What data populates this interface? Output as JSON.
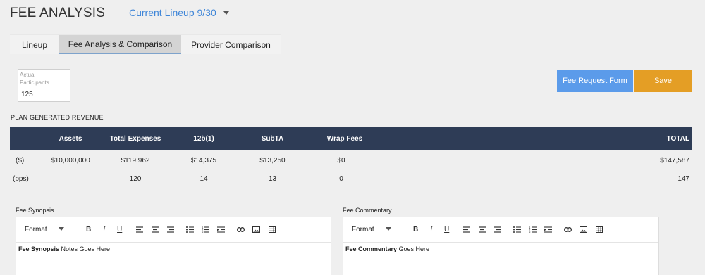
{
  "header": {
    "title": "FEE ANALYSIS",
    "lineup_selected": "Current Lineup 9/30"
  },
  "tabs": [
    {
      "label": "Lineup",
      "active": false
    },
    {
      "label": "Fee Analysis & Comparison",
      "active": true
    },
    {
      "label": "Provider Comparison",
      "active": false
    }
  ],
  "participants": {
    "label": "Actual Participants",
    "value": "125"
  },
  "buttons": {
    "fee_request": "Fee Request Form",
    "save": "Save"
  },
  "colors": {
    "header_bg": "#2e3c56",
    "fee_request_btn": "#5b9bea",
    "save_btn": "#e49e25",
    "link_blue": "#3f86d8"
  },
  "revenue": {
    "section_label": "PLAN GENERATED REVENUE",
    "columns": {
      "assets": "Assets",
      "total_expenses": "Total Expenses",
      "b12": "12b(1)",
      "subta": "SubTA",
      "wrap": "Wrap Fees",
      "total": "TOTAL"
    },
    "rows": [
      {
        "label": "($)",
        "assets": "$10,000,000",
        "total_expenses": "$119,962",
        "b12": "$14,375",
        "subta": "$13,250",
        "wrap": "$0",
        "total": "$147,587"
      },
      {
        "label": "(bps)",
        "assets": "",
        "total_expenses": "120",
        "b12": "14",
        "subta": "13",
        "wrap": "0",
        "total": "147"
      }
    ]
  },
  "editors": {
    "synopsis": {
      "title": "Fee Synopsis",
      "format_label": "Format",
      "content_bold": "Fee Synopsis",
      "content_rest": " Notes Goes Here"
    },
    "commentary": {
      "title": "Fee Commentary",
      "format_label": "Format",
      "content_bold": "Fee Commentary",
      "content_rest": " Goes Here"
    }
  },
  "toolbar_icons": [
    "bold-icon",
    "italic-icon",
    "underline-icon",
    "align-left-icon",
    "align-center-icon",
    "align-right-icon",
    "bullet-list-icon",
    "numbered-list-icon",
    "indent-icon",
    "link-icon",
    "image-icon",
    "table-icon"
  ]
}
